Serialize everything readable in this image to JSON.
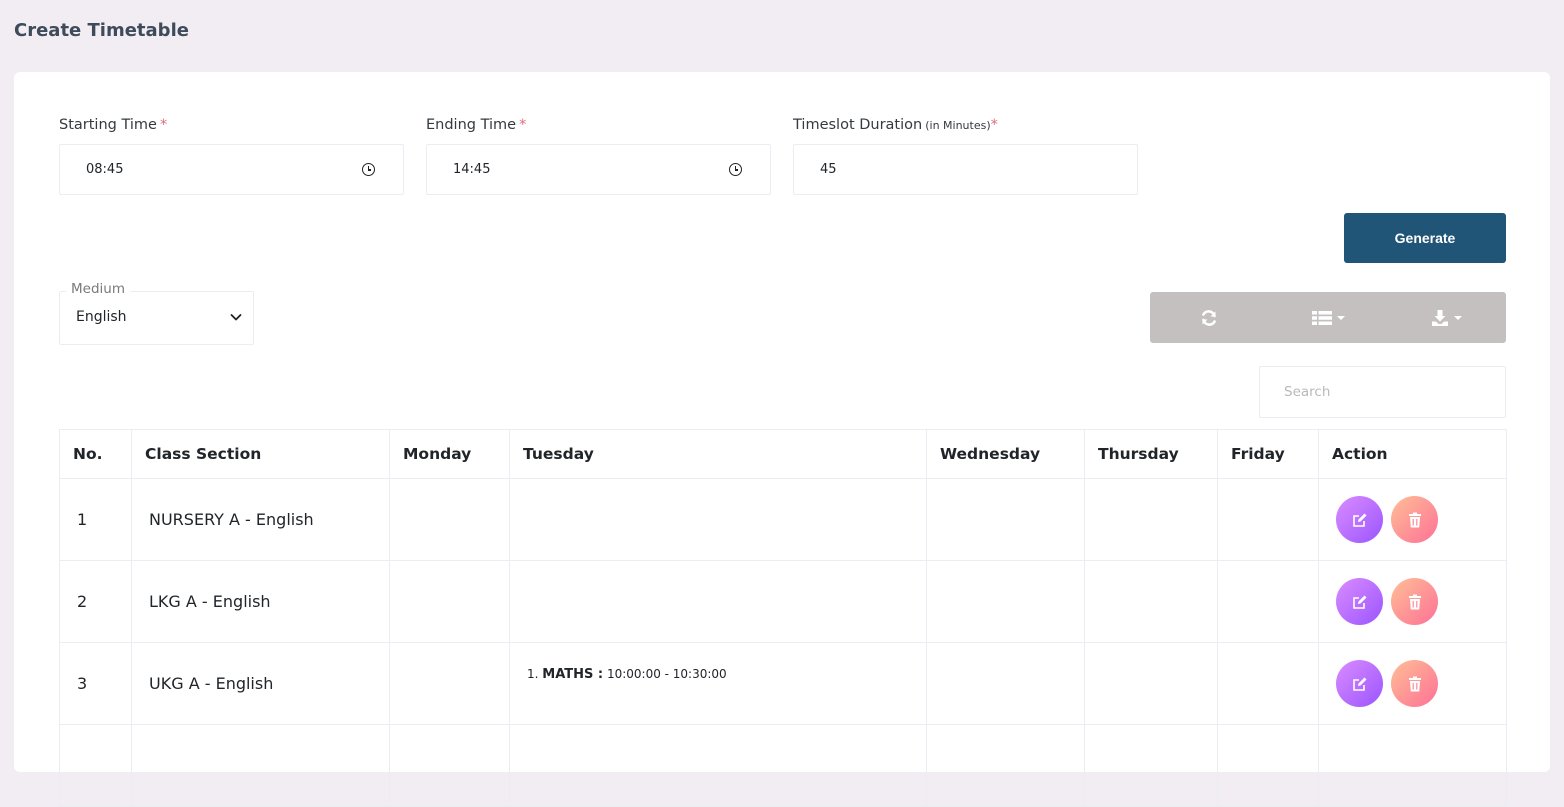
{
  "page": {
    "title": "Create Timetable"
  },
  "form": {
    "start": {
      "label": "Starting Time",
      "required_mark": "*",
      "value": "08:45"
    },
    "end": {
      "label": "Ending Time",
      "required_mark": "*",
      "value": "14:45"
    },
    "duration": {
      "label": "Timeslot Duration",
      "hint": "(in Minutes)",
      "required_mark": "*",
      "value": "45"
    },
    "generate_label": "Generate"
  },
  "filter": {
    "medium_label": "Medium",
    "medium_value": "English"
  },
  "toolbar": {
    "refresh_icon": "refresh-icon",
    "columns_icon": "list-columns-icon",
    "export_icon": "download-icon"
  },
  "search": {
    "placeholder": "Search"
  },
  "table": {
    "headers": [
      "No.",
      "Class Section",
      "Monday",
      "Tuesday",
      "Wednesday",
      "Thursday",
      "Friday",
      "Action"
    ],
    "rows": [
      {
        "no": "1",
        "class_section": "NURSERY A - English",
        "tuesday_subject": "",
        "tuesday_time": ""
      },
      {
        "no": "2",
        "class_section": "LKG A - English",
        "tuesday_subject": "",
        "tuesday_time": ""
      },
      {
        "no": "3",
        "class_section": "UKG A - English",
        "tuesday_index": "1.",
        "tuesday_subject": "MATHS :",
        "tuesday_time": "10:00:00 - 10:30:00"
      }
    ]
  },
  "colors": {
    "primary_button": "#215578",
    "toolbar_bg": "#c5c0c0",
    "edit_gradient_start": "#da8cff",
    "edit_gradient_end": "#9a55ff",
    "delete_gradient_start": "#ffbf96",
    "delete_gradient_end": "#fe7096",
    "required": "#e06b7d"
  }
}
